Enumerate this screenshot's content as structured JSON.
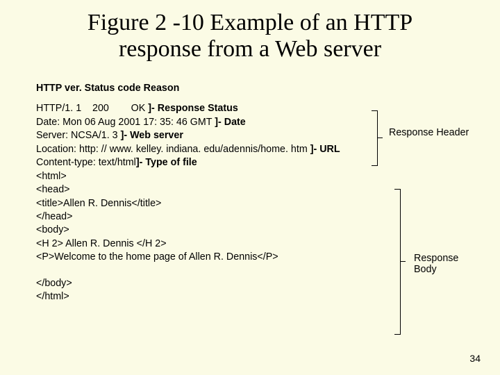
{
  "title_line1": "Figure 2 -10 Example of an HTTP",
  "title_line2": "response from a Web server",
  "header_caption": "HTTP ver. Status code Reason",
  "rows": {
    "status_plain": "HTTP/1. 1    200        OK ",
    "status_bold": "]- Response Status",
    "date_plain": "Date: Mon 06 Aug 2001 17: 35: 46 GMT ",
    "date_bold": "]- Date",
    "server_plain": "Server: NCSA/1. 3 ",
    "server_bold": "]- Web server",
    "location_plain": "Location: http: // www. kelley. indiana. edu/adennis/home. htm ",
    "location_bold": "]- URL",
    "ctype_plain": "Content-type: text/html",
    "ctype_bold": "]-  Type of file",
    "b1": "<html>",
    "b2": "<head>",
    "b3": "<title>Allen R. Dennis</title>",
    "b4": "</head>",
    "b5": "<body>",
    "b6": "<H 2> Allen R. Dennis </H 2>",
    "b7": "<P>Welcome to the home page of Allen R. Dennis</P>",
    "b8": "</body>",
    "b9": "</html>"
  },
  "side_header": "Response Header",
  "side_body_l1": "Response",
  "side_body_l2": "Body",
  "pagenum": "34"
}
